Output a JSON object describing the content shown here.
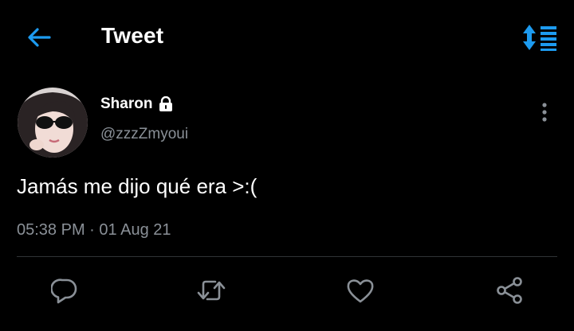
{
  "header": {
    "title": "Tweet",
    "back_icon": "arrow-left-icon",
    "sort_icon": "sort-list-icon",
    "accent_color": "#1d9bf0"
  },
  "author": {
    "name": "Sharon",
    "handle": "@zzzZmyoui",
    "protected_icon": "lock-icon"
  },
  "tweet": {
    "text": "Jamás me dijo qué era >:(",
    "time": "05:38 PM",
    "separator": "·",
    "date": "01 Aug 21"
  },
  "actions": {
    "reply_icon": "reply-icon",
    "retweet_icon": "retweet-icon",
    "like_icon": "heart-icon",
    "share_icon": "share-icon",
    "icon_color": "#8a9097"
  }
}
